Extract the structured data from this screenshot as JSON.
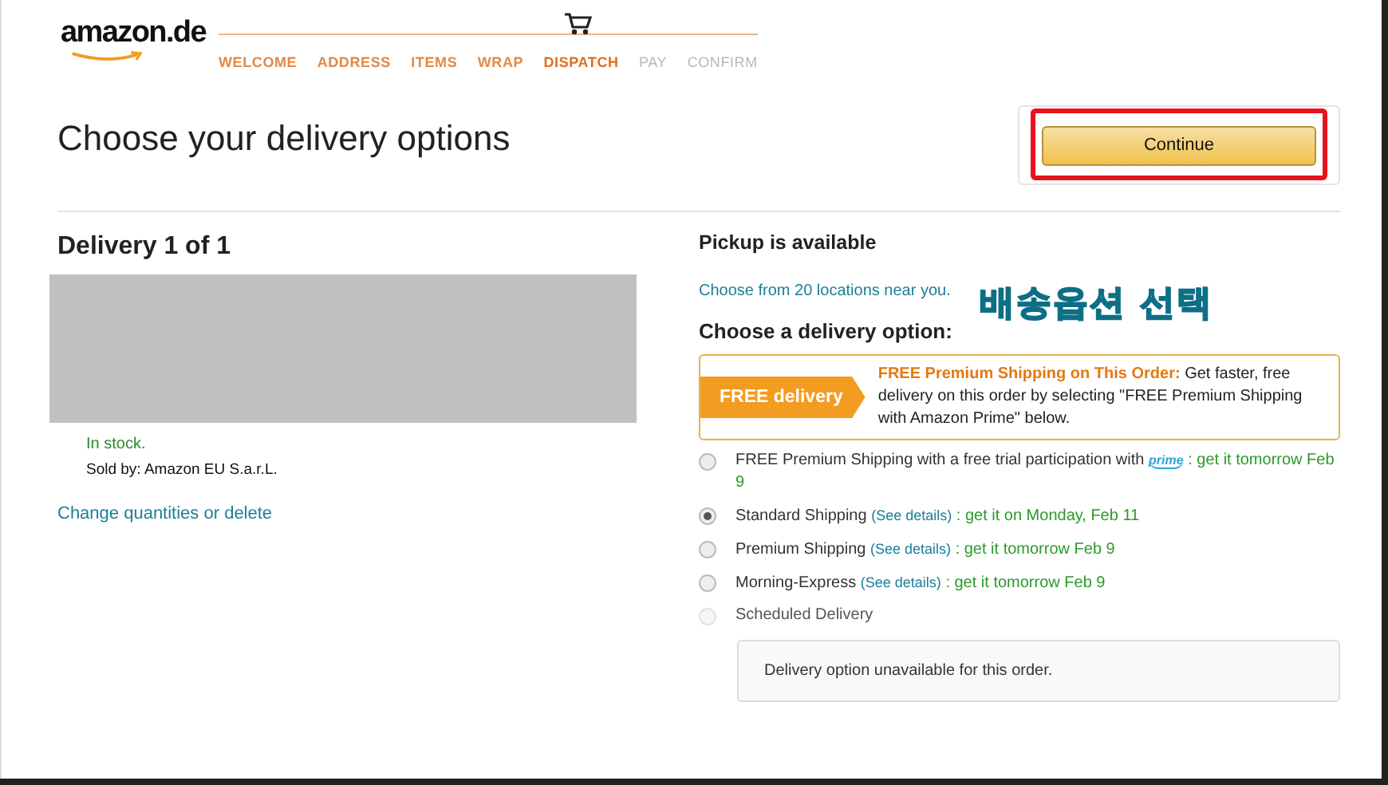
{
  "header": {
    "logo": "amazon.de",
    "steps": [
      {
        "label": "WELCOME",
        "completed": true,
        "selected": false
      },
      {
        "label": "ADDRESS",
        "completed": true,
        "selected": false
      },
      {
        "label": "ITEMS",
        "completed": true,
        "selected": false
      },
      {
        "label": "WRAP",
        "completed": true,
        "selected": false
      },
      {
        "label": "DISPATCH",
        "completed": false,
        "selected": true
      },
      {
        "label": "PAY",
        "completed": false,
        "selected": false
      },
      {
        "label": "CONFIRM",
        "completed": false,
        "selected": false
      }
    ]
  },
  "title": "Choose your delivery options",
  "continue_button": {
    "label": "Continue",
    "highlighted": true
  },
  "delivery": {
    "heading": "Delivery 1 of 1",
    "redacted": true,
    "stock": "In stock.",
    "sold_by": "Sold by: Amazon EU S.a.r.L.",
    "change_link": "Change quantities or delete"
  },
  "pickup": {
    "heading": "Pickup is available",
    "link": "Choose from 20 locations near you."
  },
  "annotation": "배송옵션 선택",
  "options_heading": "Choose a delivery option:",
  "promo": {
    "badge": "FREE delivery",
    "title": "FREE Premium Shipping on This Order:",
    "text": "Get faster, free delivery on this order by selecting \"FREE Premium Shipping with Amazon Prime\" below."
  },
  "options": [
    {
      "label": "FREE Premium Shipping with a free trial participation with",
      "prime": "prime",
      "eta": ": get it tomorrow Feb 9",
      "selected": false,
      "disabled": false
    },
    {
      "label": "Standard Shipping",
      "details": "(See details)",
      "eta": ": get it on Monday, Feb 11",
      "selected": true,
      "disabled": false
    },
    {
      "label": "Premium Shipping",
      "details": "(See details)",
      "eta": ": get it tomorrow Feb 9",
      "selected": false,
      "disabled": false
    },
    {
      "label": "Morning-Express",
      "details": "(See details)",
      "eta": ": get it tomorrow Feb 9",
      "selected": false,
      "disabled": false
    },
    {
      "label": "Scheduled Delivery",
      "selected": false,
      "disabled": true,
      "note": "Delivery option unavailable for this order."
    }
  ]
}
